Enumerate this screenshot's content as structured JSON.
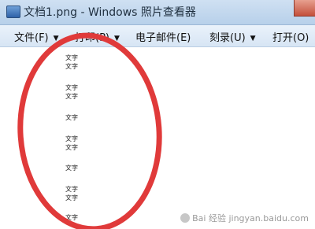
{
  "window": {
    "title": "文档1.png - Windows 照片查看器"
  },
  "menubar": {
    "items": [
      {
        "label": "文件(F)",
        "has_dropdown": true
      },
      {
        "label": "打印(P)",
        "has_dropdown": true
      },
      {
        "label": "电子邮件(E)",
        "has_dropdown": false
      },
      {
        "label": "刻录(U)",
        "has_dropdown": true
      },
      {
        "label": "打开(O)",
        "has_dropdown": false
      }
    ]
  },
  "document": {
    "lines": [
      "文字",
      "文字",
      "文字",
      "文字",
      "文字",
      "文字",
      "文字",
      "文字",
      "文字",
      "文字",
      "文字",
      "文字"
    ]
  },
  "annotation": {
    "color": "#e03a3a"
  },
  "watermark": {
    "text": "Bai 经验 jingyan.baidu.com"
  }
}
